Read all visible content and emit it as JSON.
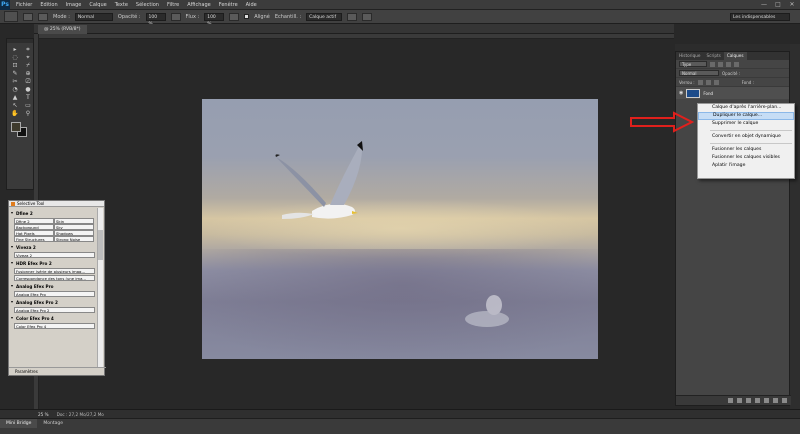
{
  "app": {
    "logo": "Ps"
  },
  "menu": [
    "Fichier",
    "Edition",
    "Image",
    "Calque",
    "Texte",
    "Sélection",
    "Filtre",
    "Affichage",
    "Fenêtre",
    "Aide"
  ],
  "window_controls": [
    "—",
    "□",
    "✕"
  ],
  "options_bar": {
    "mode_label": "Mode :",
    "mode_value": "Normal",
    "opacity_label": "Opacité :",
    "opacity_value": "100 %",
    "flux_label": "Flux :",
    "flux_value": "100 %",
    "aligned_label": "Aligné",
    "sample_label": "Echantill. :",
    "sample_value": "Calque actif",
    "workspace_value": "Les indispensables"
  },
  "document": {
    "tab_label": "@ 25% (RVB/8*)"
  },
  "tools": [
    "▸",
    "⌗",
    "◌",
    "⌖",
    "⊡",
    "⌿",
    "✎",
    "⊕",
    "✂",
    "⎚",
    "◔",
    "●",
    "▲",
    "T",
    "↖",
    "▭",
    "✋",
    "⚲"
  ],
  "colors": {
    "foreground": "#3e3a2c",
    "background": "#111111",
    "selection_highlight": "#c6ddf5"
  },
  "selective_tool": {
    "title": "Selective Tool",
    "sections": [
      {
        "name": "Dfine 2",
        "grid": [
          "Dfine 2",
          "Skin",
          "Background",
          "Sky",
          "Hot Pixels",
          "Shadows",
          "Fine Structures",
          "Strong Noise"
        ]
      },
      {
        "name": "Viveza 2",
        "buttons": [
          "Viveza 2"
        ]
      },
      {
        "name": "HDR Efex Pro 2",
        "buttons": [
          "Fusionner (série de plusieurs imag...",
          "Correspondance des tons (une ima..."
        ]
      },
      {
        "name": "Analog Efex Pro",
        "buttons": [
          "Analog Efex Pro"
        ]
      },
      {
        "name": "Analog Efex Pro 2",
        "buttons": [
          "Analog Efex Pro 2"
        ]
      },
      {
        "name": "Color Efex Pro 4",
        "buttons": [
          "Color Efex Pro 4"
        ]
      }
    ],
    "footer": "Paramètres"
  },
  "layers_panel": {
    "tabs": [
      "Historique",
      "Scripts",
      "Calques"
    ],
    "active_tab": "Calques",
    "filter_label": "Type",
    "blend_value": "Normal",
    "opacity_label": "Opacité :",
    "lock_label": "Verrou :",
    "fill_label": "Fond :",
    "layer_name": "Fond"
  },
  "context_menu": {
    "items": [
      {
        "label": "Calque d'après l'arrière-plan...",
        "highlight": false
      },
      {
        "label": "Dupliquer le calque...",
        "highlight": true
      },
      {
        "label": "Supprimer le calque",
        "highlight": false
      },
      {
        "sep": true
      },
      {
        "label": "Convertir en objet dynamique",
        "highlight": false
      },
      {
        "sep": true
      },
      {
        "label": "Fusionner les calques",
        "highlight": false
      },
      {
        "label": "Fusionner les calques visibles",
        "highlight": false
      },
      {
        "label": "Aplatir l'image",
        "highlight": false
      }
    ]
  },
  "status_bar": {
    "zoom": "25 %",
    "doc_info": "Doc : 27,2 Mo/27,2 Mo"
  },
  "bottom_tabs": [
    "Mini Bridge",
    "Montage"
  ]
}
